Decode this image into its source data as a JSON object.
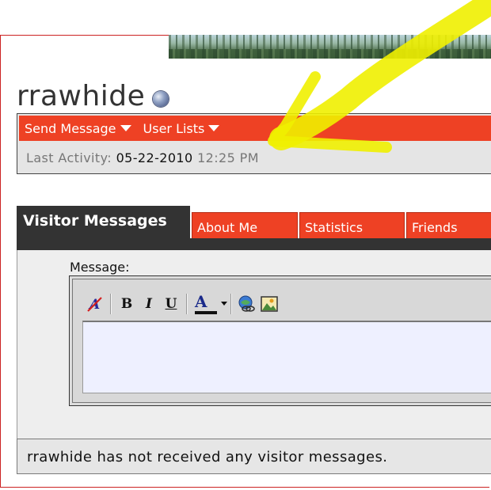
{
  "profile": {
    "username": "rrawhide",
    "status_icon": "offline-status-icon"
  },
  "actions": {
    "send_message": "Send Message",
    "user_lists": "User Lists"
  },
  "activity": {
    "label": "Last Activity:",
    "date": "05-22-2010",
    "time": "12:25 PM"
  },
  "tabs": [
    {
      "label": "Visitor Messages",
      "active": true
    },
    {
      "label": "About Me",
      "active": false
    },
    {
      "label": "Statistics",
      "active": false
    },
    {
      "label": "Friends",
      "active": false
    }
  ],
  "editor": {
    "label": "Message:",
    "textarea_value": "",
    "toolbar": [
      {
        "icon": "remove-formatting-icon"
      },
      {
        "icon": "bold-icon",
        "glyph": "B"
      },
      {
        "icon": "italic-icon",
        "glyph": "I"
      },
      {
        "icon": "underline-icon",
        "glyph": "U"
      },
      {
        "icon": "font-color-icon",
        "glyph": "A"
      },
      {
        "icon": "insert-link-icon"
      },
      {
        "icon": "insert-image-icon"
      }
    ]
  },
  "empty_message": "rrawhide has not received any visitor messages.",
  "colors": {
    "accent": "#ee4124",
    "dark": "#333333",
    "highlight": "#f0f000",
    "activity_highlight": "#e0e000"
  }
}
